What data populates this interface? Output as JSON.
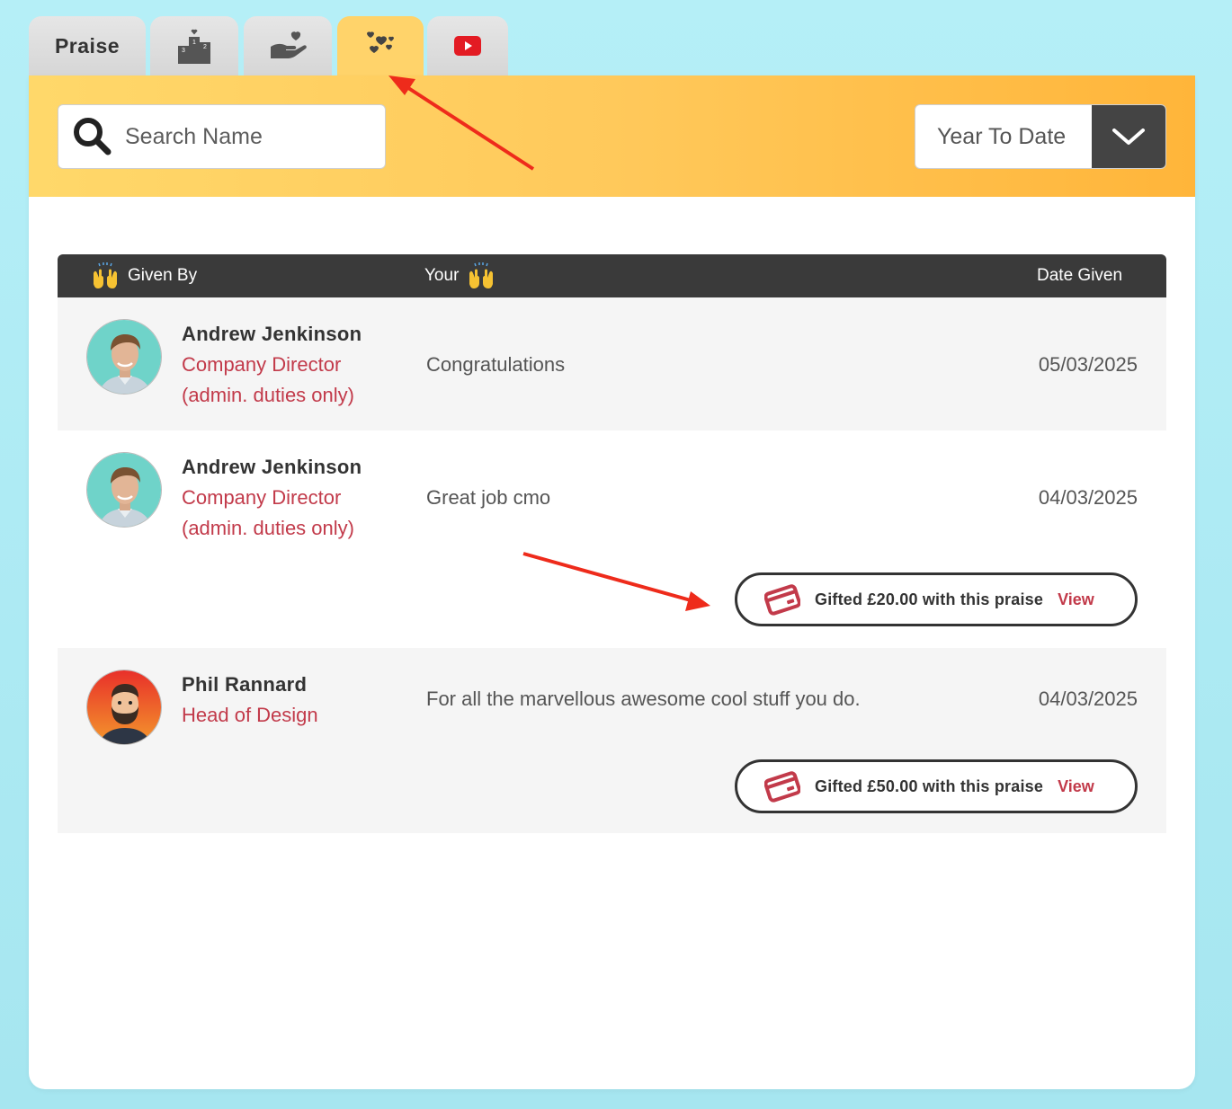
{
  "tabs": [
    {
      "label": "Praise",
      "icon": "",
      "active": false
    },
    {
      "label": "",
      "icon": "podium-icon",
      "active": false
    },
    {
      "label": "",
      "icon": "heart-in-hand-icon",
      "active": false
    },
    {
      "label": "",
      "icon": "hearts-icon",
      "active": true
    },
    {
      "label": "",
      "icon": "youtube-icon",
      "active": false
    }
  ],
  "toolbar": {
    "search_placeholder": "Search Name",
    "period": {
      "selected": "Year To Date"
    }
  },
  "table": {
    "headers": {
      "given_by": "Given By",
      "your": "Your",
      "date_given": "Date Given"
    },
    "rows": [
      {
        "giver_name": "Andrew Jenkinson",
        "role_line1": "Company Director",
        "role_line2": "(admin. duties only)",
        "message": "Congratulations",
        "date": "05/03/2025",
        "gift": null
      },
      {
        "giver_name": "Andrew Jenkinson",
        "role_line1": "Company Director",
        "role_line2": "(admin. duties only)",
        "message": "Great job cmo",
        "date": "04/03/2025",
        "gift": {
          "text": "Gifted £20.00 with this praise",
          "link": "View"
        }
      },
      {
        "giver_name": "Phil Rannard",
        "role_line1": "Head of Design",
        "role_line2": "",
        "message": "For all the marvellous awesome cool stuff you do.",
        "date": "04/03/2025",
        "gift": {
          "text": "Gifted £50.00 with this praise",
          "link": "View"
        }
      }
    ]
  },
  "colors": {
    "accent_red": "#c23a4a",
    "header_dark": "#3a3a3a",
    "toolbar_yellow": "#ffc95b",
    "annotation_arrow": "#ee2b1b",
    "youtube_red": "#e31b23"
  }
}
